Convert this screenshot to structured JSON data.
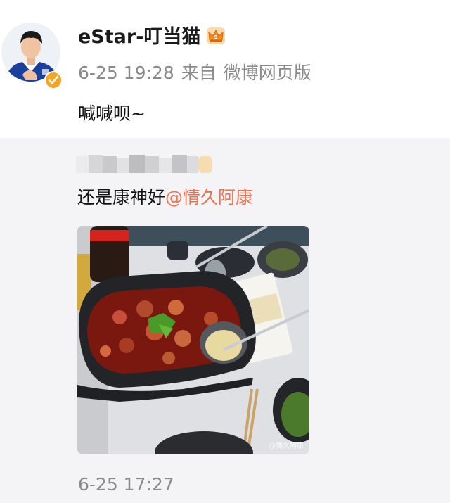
{
  "post": {
    "username": "eStar-叮当猫",
    "date": "6-25 19:28",
    "source_prefix": "来自",
    "source": "微博网页版",
    "text": "喊喊呗~"
  },
  "repost": {
    "text_before": "还是康神好",
    "mention": "@情久阿康",
    "image_watermark": "@情久阿康",
    "time": "6-25 17:27"
  },
  "colors": {
    "mention": "#eb7350",
    "meta": "#8a8a8a",
    "verified_badge": "#f5a623"
  }
}
